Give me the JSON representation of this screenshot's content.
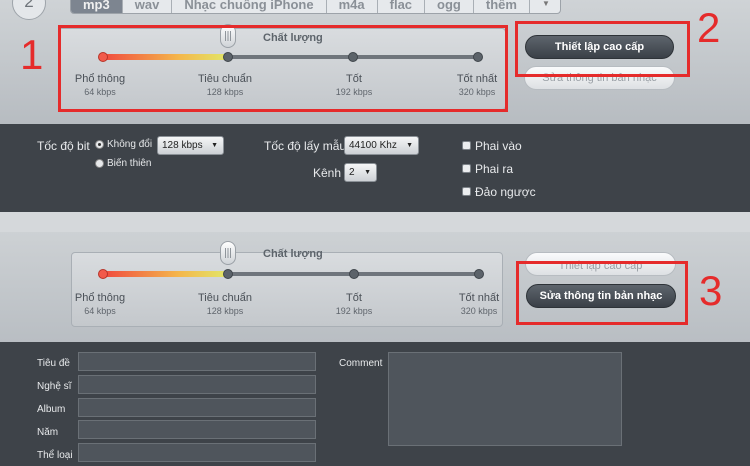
{
  "step_badge": "2",
  "format_tabs": [
    "mp3",
    "wav",
    "Nhạc chuông iPhone",
    "m4a",
    "flac",
    "ogg",
    "thêm"
  ],
  "quality": {
    "title": "Chất lượng",
    "levels": [
      {
        "name": "Phổ thông",
        "rate": "64 kbps"
      },
      {
        "name": "Tiêu chuẩn",
        "rate": "128 kbps"
      },
      {
        "name": "Tốt",
        "rate": "192 kbps"
      },
      {
        "name": "Tốt nhất",
        "rate": "320 kbps"
      }
    ],
    "selected_level": "Tiêu chuẩn"
  },
  "buttons": {
    "advanced": "Thiết lập cao cấp",
    "edit_info": "Sửa thông tin bản nhạc"
  },
  "annotations": [
    "1",
    "2",
    "3"
  ],
  "advanced_settings": {
    "bitrate_label": "Tốc độ bit",
    "bitrate_mode_constant": "Không đổi",
    "bitrate_mode_variable": "Biến thiên",
    "bitrate_value": "128 kbps",
    "sample_rate_label": "Tốc độ lấy mẫu",
    "sample_rate_value": "44100 Khz",
    "channel_label": "Kênh",
    "channel_value": "2",
    "fade_in": "Phai vào",
    "fade_out": "Phai ra",
    "reverse": "Đảo ngược"
  },
  "track_info": {
    "title_label": "Tiêu đề",
    "artist_label": "Nghệ sĩ",
    "album_label": "Album",
    "year_label": "Năm",
    "genre_label": "Thể loại",
    "comment_label": "Comment"
  },
  "colors": {
    "annotation": "#e52b2b",
    "dark_panel": "#3e4349",
    "slider_fill_start": "#f04a3f",
    "slider_fill_end": "#e1e86a"
  }
}
